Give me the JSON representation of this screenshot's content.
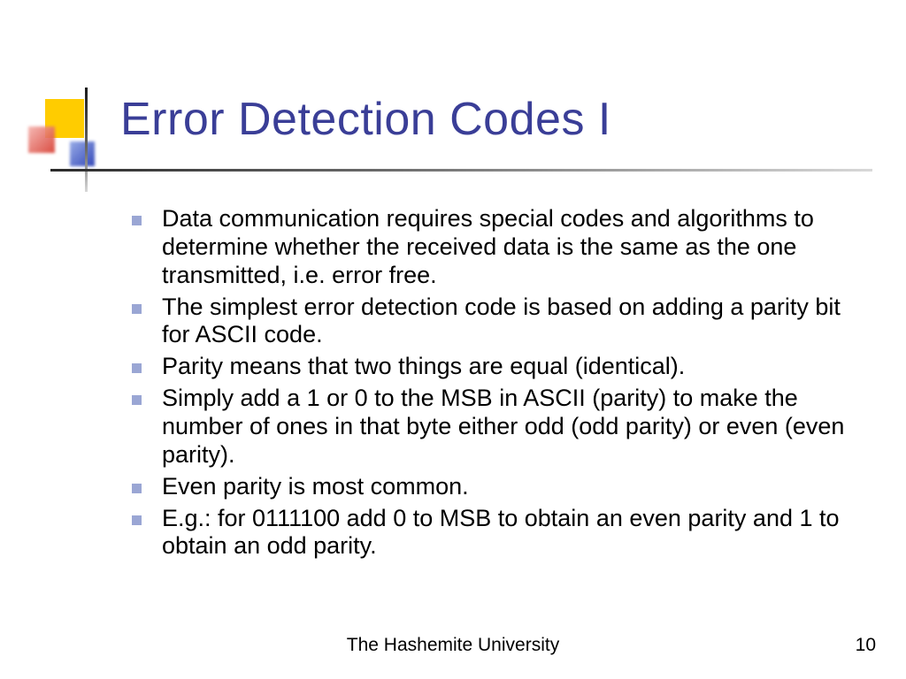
{
  "title": "Error Detection Codes I",
  "bullets": [
    "Data communication requires special codes and algorithms to determine whether the received data is the same as the one transmitted, i.e. error free.",
    "The simplest error detection code is based on adding a parity bit for ASCII code.",
    "Parity means that two things are equal (identical).",
    "Simply add a 1 or 0 to the MSB in ASCII (parity) to make the number of ones in that byte either odd (odd parity) or even (even parity).",
    "Even parity is most common.",
    "E.g.: for 0111100 add 0 to MSB to obtain an even parity and 1 to obtain an odd parity."
  ],
  "footer": {
    "org": "The Hashemite University",
    "page": "10"
  }
}
